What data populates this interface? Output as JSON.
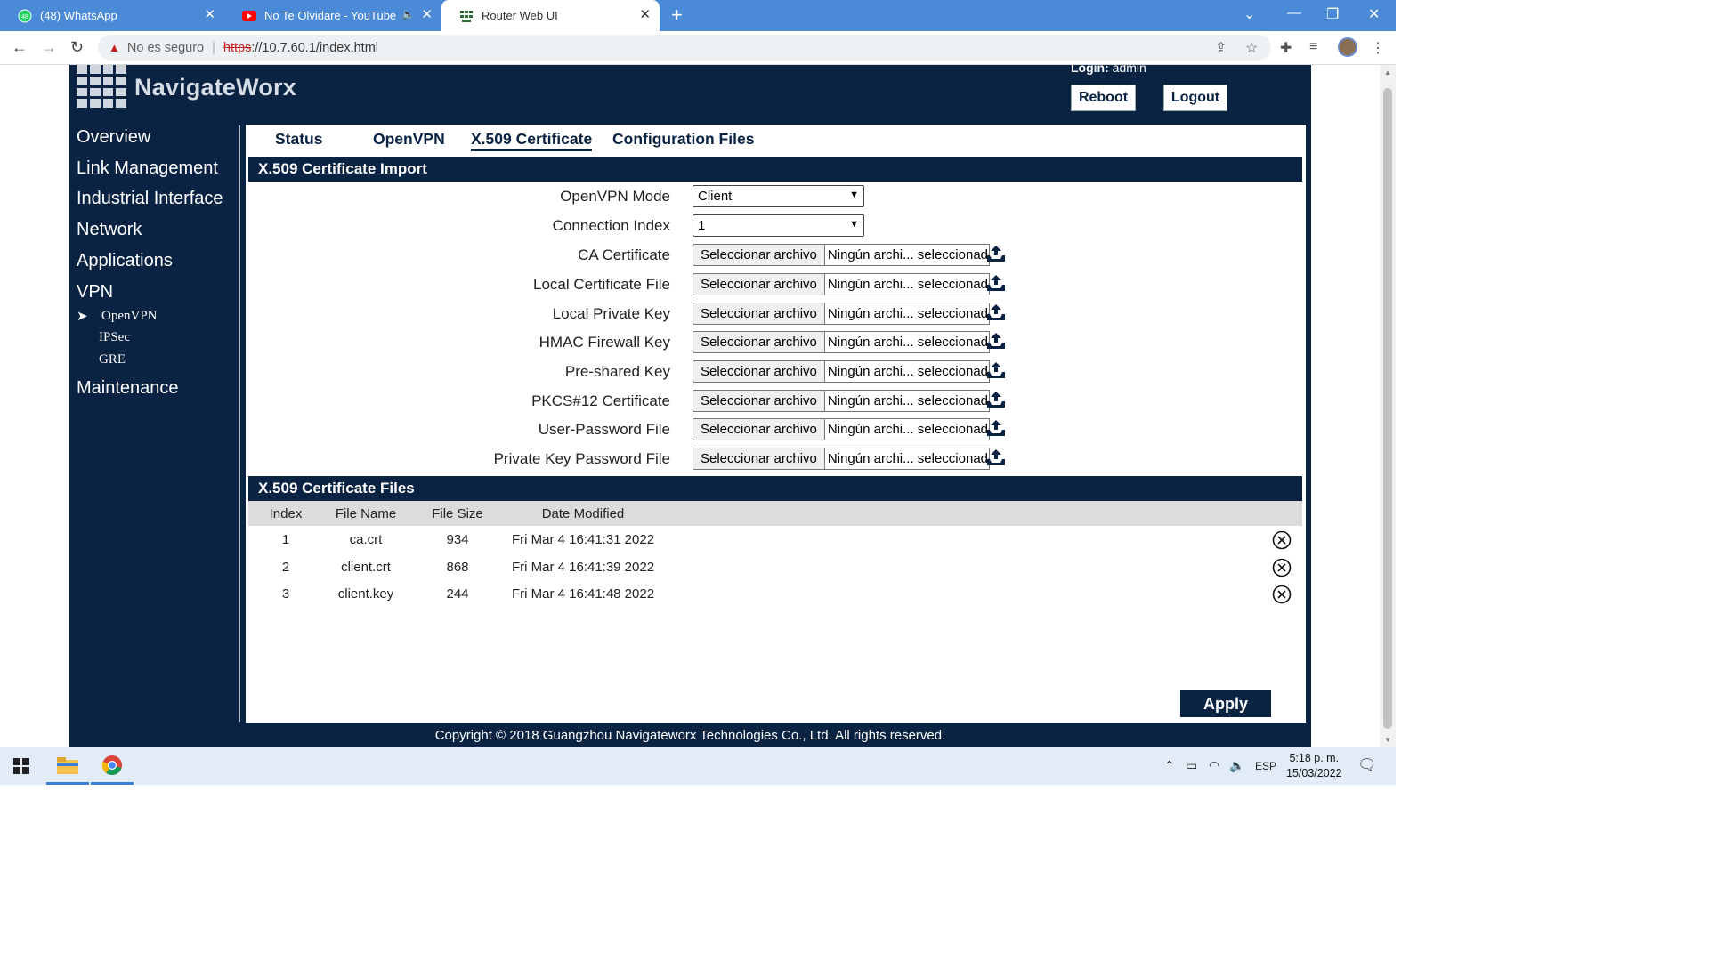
{
  "browser": {
    "tabs": [
      {
        "title": "(48) WhatsApp",
        "icon": "whatsapp-icon"
      },
      {
        "title": "No Te Olvidare - YouTube",
        "icon": "youtube-icon"
      },
      {
        "title": "Router Web UI",
        "icon": "router-icon",
        "active": true
      }
    ],
    "new_tab": "+",
    "url_security": "No es seguro",
    "url_scheme": "https",
    "url_rest": "://10.7.60.1/index.html"
  },
  "router": {
    "brand": "NavigateWorx",
    "login_label": "Login:",
    "login_user": "admin",
    "reboot": "Reboot",
    "logout": "Logout",
    "nav": [
      "Overview",
      "Link Management",
      "Industrial Interface",
      "Network",
      "Applications",
      "VPN",
      "Maintenance"
    ],
    "vpn_sub": [
      "OpenVPN",
      "IPSec",
      "GRE"
    ],
    "tabs": [
      "Status",
      "OpenVPN",
      "X.509 Certificate",
      "Configuration Files"
    ],
    "import_title": "X.509 Certificate Import",
    "fields": {
      "mode_label": "OpenVPN Mode",
      "mode_value": "Client",
      "index_label": "Connection Index",
      "index_value": "1"
    },
    "file_button": "Seleccionar archivo",
    "file_none": "Ningún archi... seleccionado",
    "file_fields": [
      "CA Certificate",
      "Local Certificate File",
      "Local Private Key",
      "HMAC Firewall Key",
      "Pre-shared Key",
      "PKCS#12 Certificate",
      "User-Password File",
      "Private Key Password File"
    ],
    "files_title": "X.509 Certificate Files",
    "table_headers": [
      "Index",
      "File Name",
      "File Size",
      "Date Modified"
    ],
    "table_rows": [
      {
        "index": "1",
        "name": "ca.crt",
        "size": "934",
        "date": "Fri Mar 4 16:41:31 2022"
      },
      {
        "index": "2",
        "name": "client.crt",
        "size": "868",
        "date": "Fri Mar 4 16:41:39 2022"
      },
      {
        "index": "3",
        "name": "client.key",
        "size": "244",
        "date": "Fri Mar 4 16:41:48 2022"
      }
    ],
    "apply": "Apply",
    "copyright": "Copyright © 2018 Guangzhou Navigateworx Technologies Co., Ltd. All rights reserved."
  },
  "taskbar": {
    "lang": "ESP",
    "time": "5:18 p. m.",
    "date": "15/03/2022"
  }
}
